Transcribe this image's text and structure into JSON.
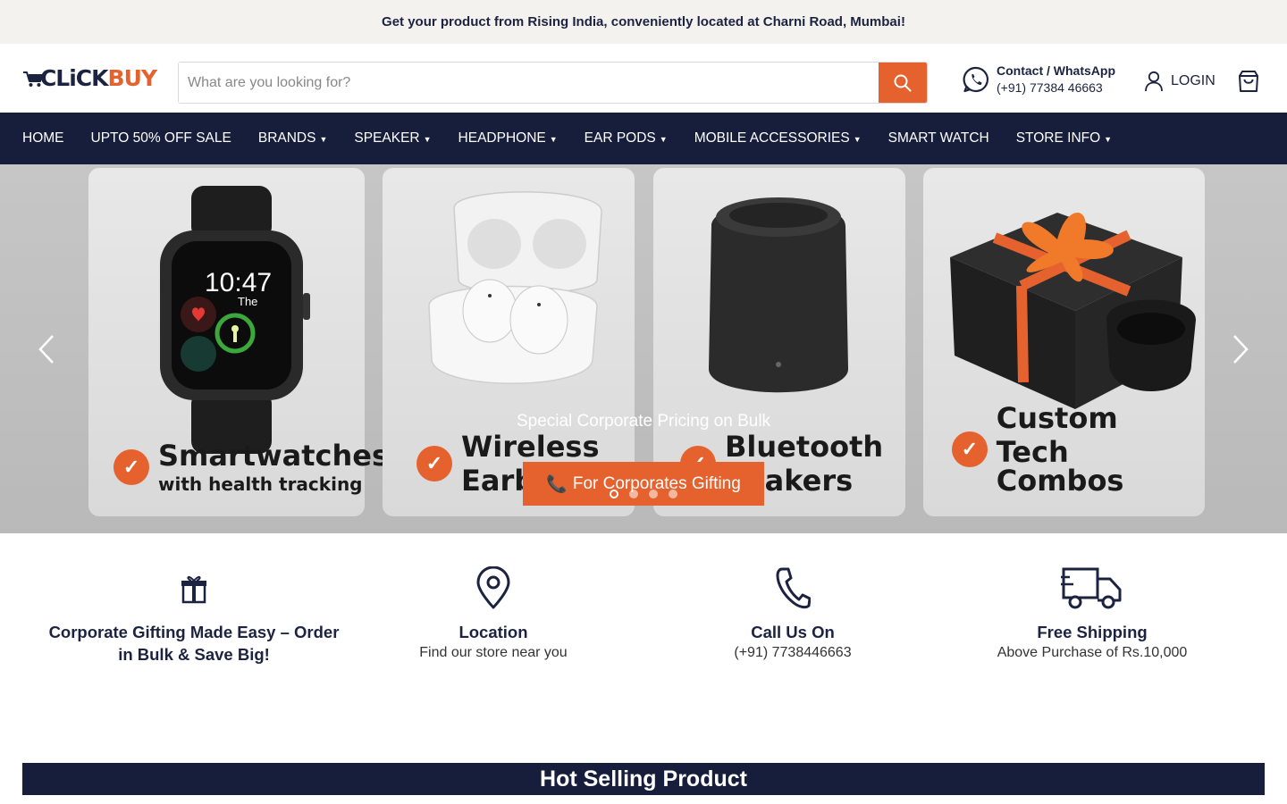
{
  "announcement": "Get your product from Rising India, conveniently located at Charni Road, Mumbai!",
  "brand": {
    "logo_text_1": "CLiCK",
    "logo_text_2": "BUY",
    "accent": "#e5622f",
    "navy": "#161e3c"
  },
  "search": {
    "placeholder": "What are you looking for?",
    "icon": "search-icon"
  },
  "contact": {
    "title": "Contact / WhatsApp",
    "phone": "(+91) 77384 46663",
    "icon": "whatsapp-icon"
  },
  "account": {
    "login_label": "LOGIN",
    "icon": "user-icon"
  },
  "cart": {
    "icon": "cart-bag-icon"
  },
  "nav": {
    "items": [
      {
        "label": "HOME",
        "dropdown": false
      },
      {
        "label": "UPTO 50% OFF SALE",
        "dropdown": false
      },
      {
        "label": "BRANDS",
        "dropdown": true
      },
      {
        "label": "SPEAKER",
        "dropdown": true
      },
      {
        "label": "HEADPHONE",
        "dropdown": true
      },
      {
        "label": "EAR PODS",
        "dropdown": true
      },
      {
        "label": "MOBILE ACCESSORIES",
        "dropdown": true
      },
      {
        "label": "SMART WATCH",
        "dropdown": false
      },
      {
        "label": "STORE INFO",
        "dropdown": true
      }
    ]
  },
  "hero": {
    "cards": [
      {
        "title": "Smartwatches",
        "subtitle": "with health tracking",
        "watch_time": "10:47",
        "watch_day": "The"
      },
      {
        "title": "Wireless",
        "subtitle": "Earb"
      },
      {
        "title": "Bluetooth",
        "subtitle": "peakers"
      },
      {
        "title": "Custom",
        "subtitle": "Tech Combos"
      }
    ],
    "caption": "Special Corporate Pricing on Bulk",
    "cta_label": "For Corporates Gifting",
    "cta_icon": "phone-emoji-icon",
    "slides_total": 4,
    "active_slide": 1
  },
  "features": [
    {
      "icon": "gift-icon",
      "title": "Corporate Gifting Made Easy – Order in Bulk & Save Big!",
      "subtitle": ""
    },
    {
      "icon": "location-pin-icon",
      "title": "Location",
      "subtitle": "Find our store near you"
    },
    {
      "icon": "phone-icon",
      "title": "Call Us On",
      "subtitle": "(+91) 7738446663"
    },
    {
      "icon": "truck-icon",
      "title": "Free Shipping",
      "subtitle": "Above Purchase of Rs.10,000"
    }
  ],
  "section_title": "Hot Selling Product"
}
